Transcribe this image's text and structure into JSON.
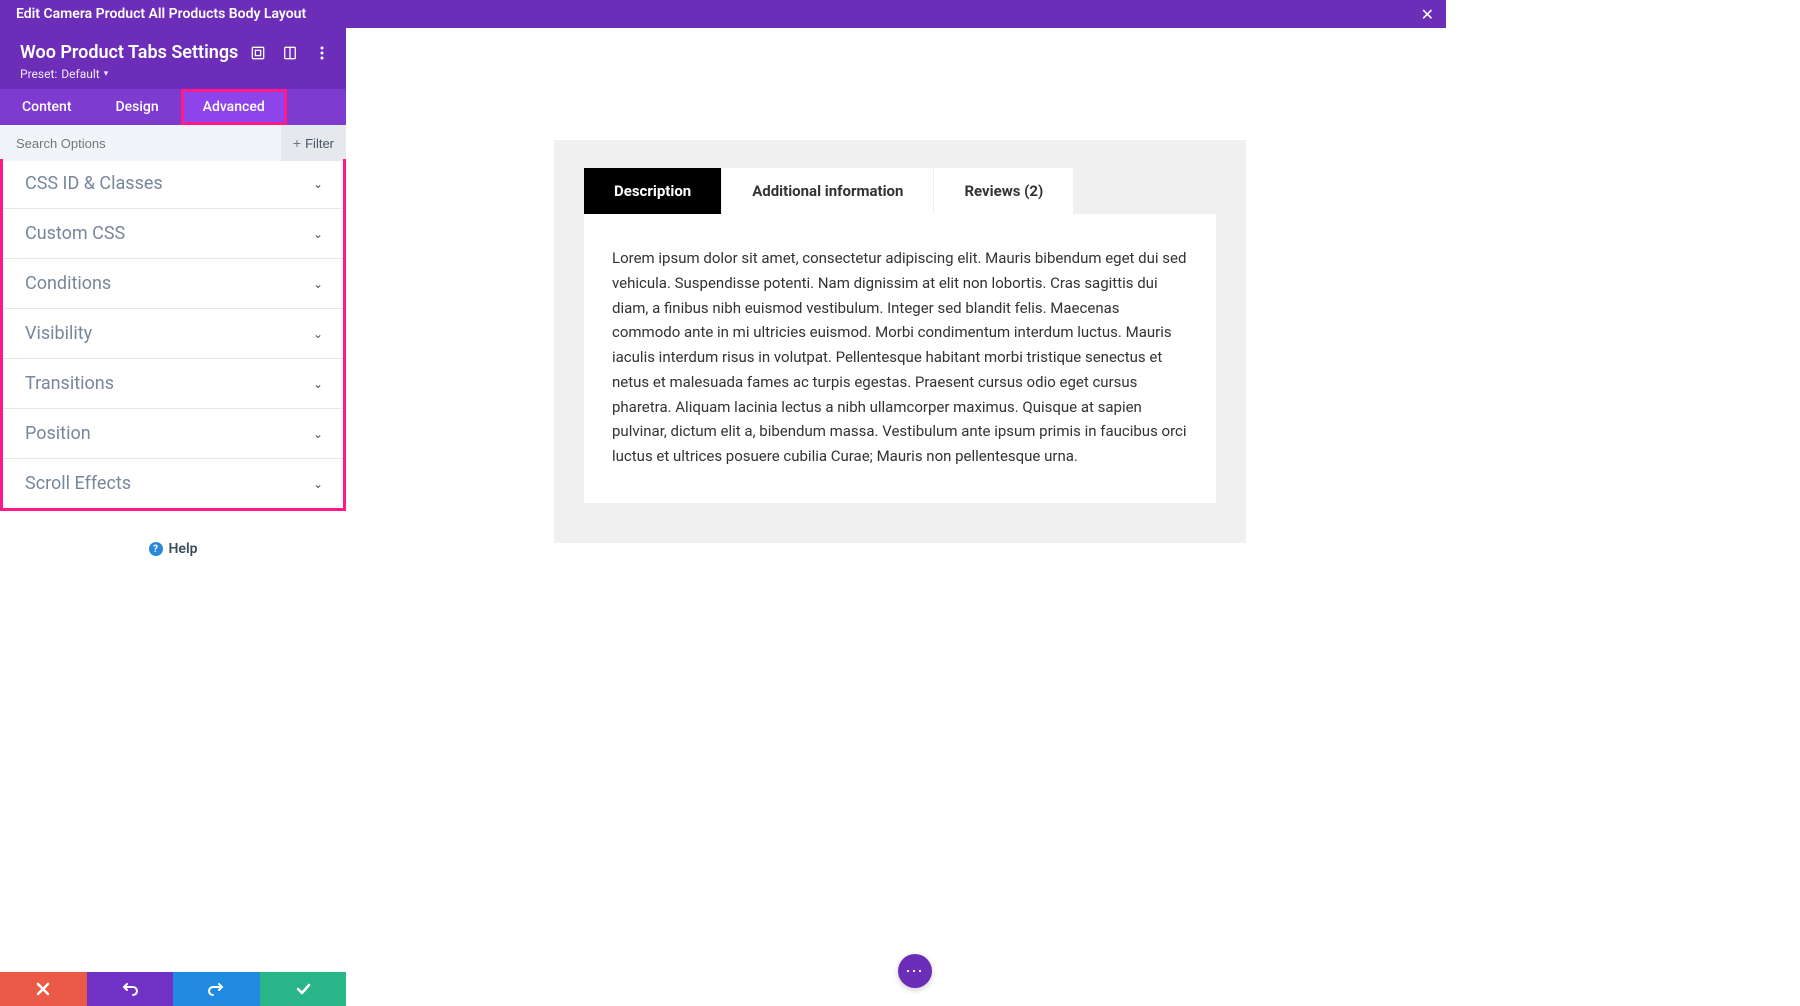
{
  "topbar": {
    "title": "Edit Camera Product All Products Body Layout"
  },
  "settings": {
    "title": "Woo Product Tabs Settings",
    "preset_label": "Preset:",
    "preset_value": "Default"
  },
  "tabs": {
    "content": "Content",
    "design": "Design",
    "advanced": "Advanced"
  },
  "search": {
    "placeholder": "Search Options"
  },
  "filter": {
    "label": "Filter"
  },
  "panels": [
    {
      "label": "CSS ID & Classes"
    },
    {
      "label": "Custom CSS"
    },
    {
      "label": "Conditions"
    },
    {
      "label": "Visibility"
    },
    {
      "label": "Transitions"
    },
    {
      "label": "Position"
    },
    {
      "label": "Scroll Effects"
    }
  ],
  "help": {
    "label": "Help"
  },
  "preview": {
    "tabs": {
      "description": "Description",
      "additional": "Additional information",
      "reviews": "Reviews (2)"
    },
    "content": "Lorem ipsum dolor sit amet, consectetur adipiscing elit. Mauris bibendum eget dui sed vehicula. Suspendisse potenti. Nam dignissim at elit non lobortis. Cras sagittis dui diam, a finibus nibh euismod vestibulum. Integer sed blandit felis. Maecenas commodo ante in mi ultricies euismod. Morbi condimentum interdum luctus. Mauris iaculis interdum risus in volutpat. Pellentesque habitant morbi tristique senectus et netus et malesuada fames ac turpis egestas. Praesent cursus odio eget cursus pharetra. Aliquam lacinia lectus a nibh ullamcorper maximus. Quisque at sapien pulvinar, dictum elit a, bibendum massa. Vestibulum ante ipsum primis in faucibus orci luctus et ultrices posuere cubilia Curae; Mauris non pellentesque urna."
  }
}
